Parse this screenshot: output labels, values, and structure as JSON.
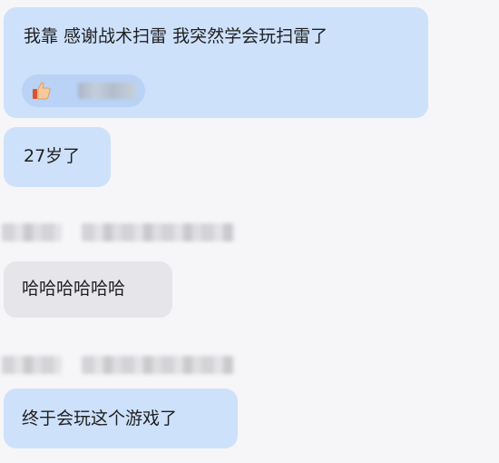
{
  "messages": [
    {
      "text": "我靠 感谢战术扫雷 我突然学会玩扫雷了",
      "reaction": {
        "icon": "thumbs-up-icon"
      }
    },
    {
      "text": "27岁了"
    },
    {
      "text": "哈哈哈哈哈哈"
    },
    {
      "text": "终于会玩这个游戏了"
    }
  ],
  "colors": {
    "background": "#f6f6f8",
    "blue_bubble": "#cde1fb",
    "gray_bubble": "#e6e6ea",
    "reaction_chip": "#b9d2f5",
    "text": "#1f1f1f"
  }
}
